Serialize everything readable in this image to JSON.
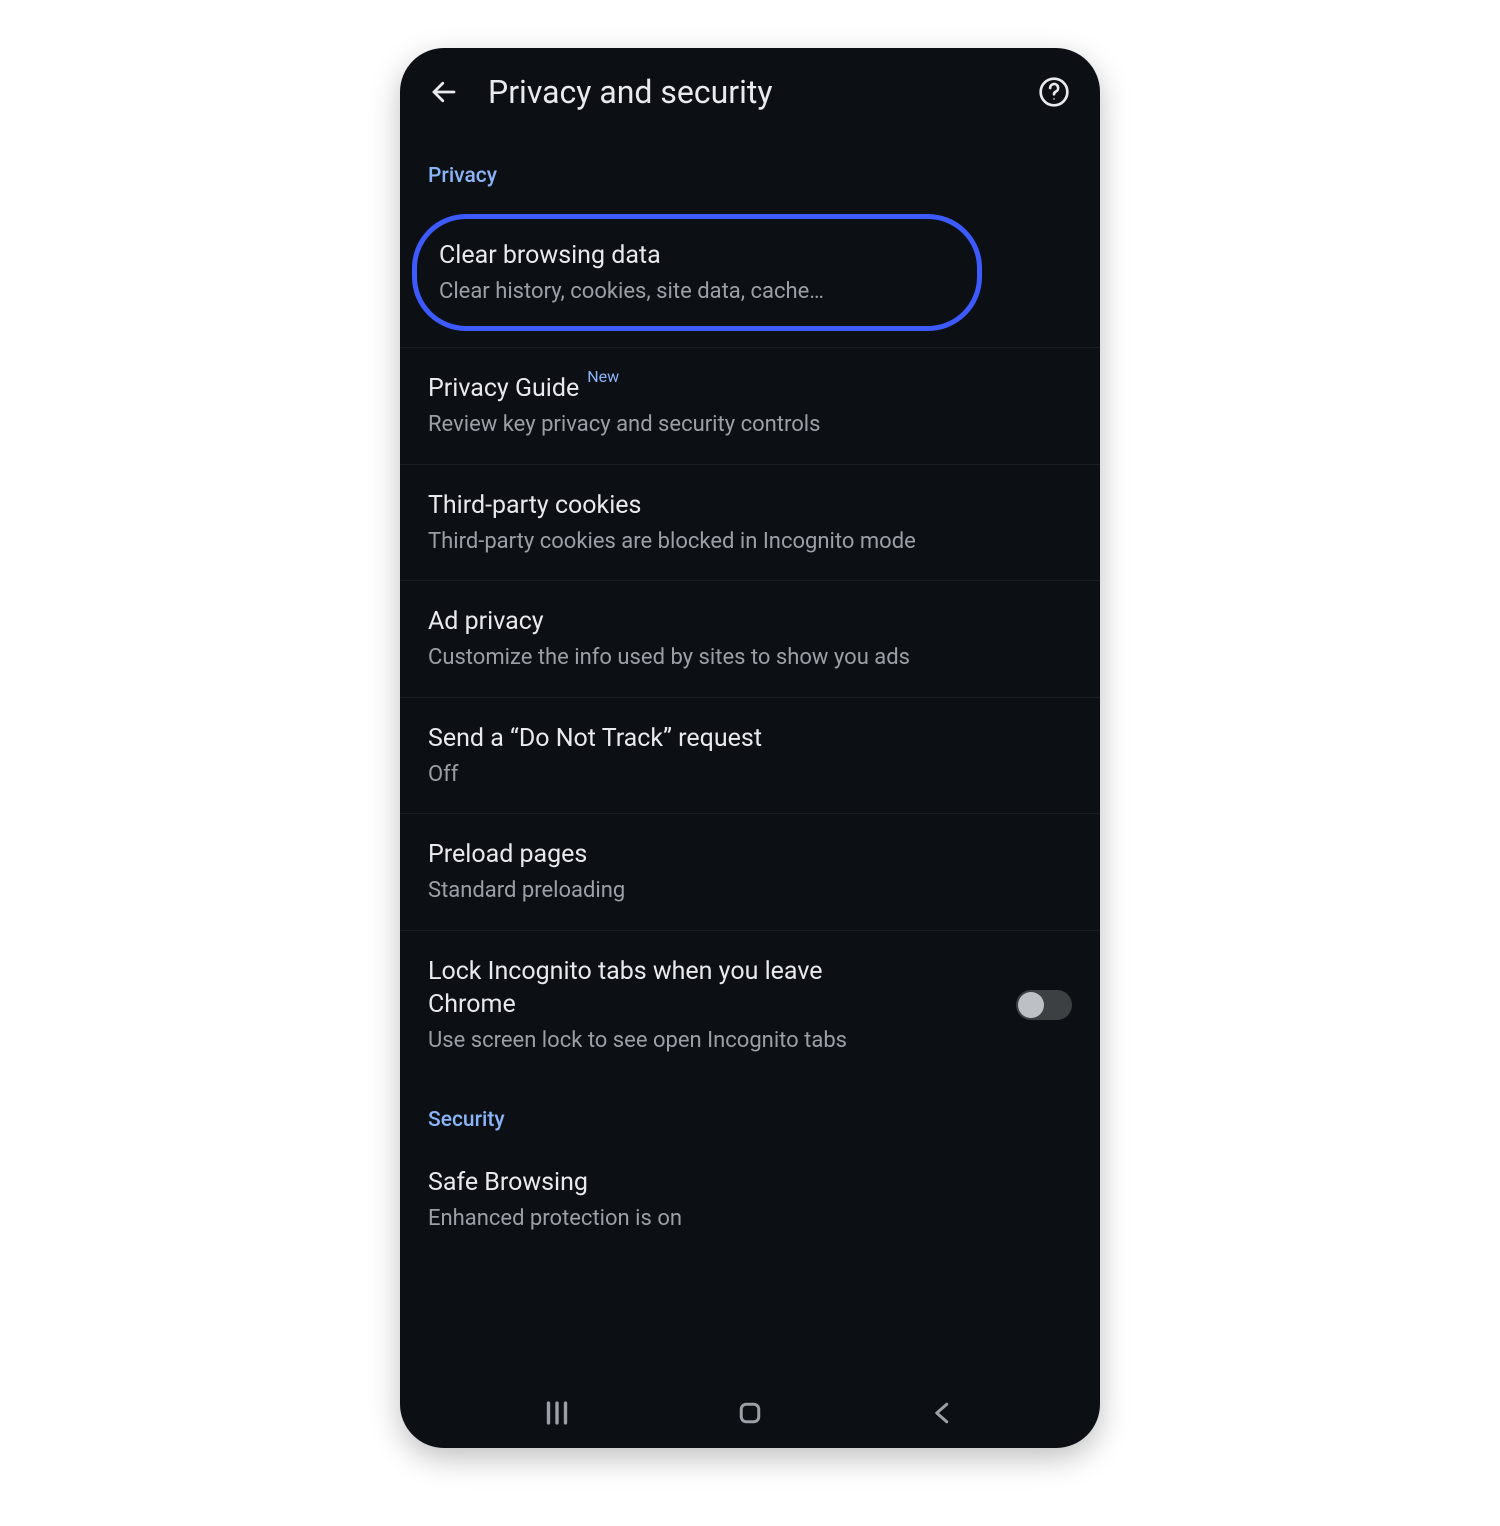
{
  "header": {
    "title": "Privacy and security"
  },
  "sections": {
    "privacy": {
      "label": "Privacy",
      "items": {
        "clear_browsing_data": {
          "title": "Clear browsing data",
          "subtitle": "Clear history, cookies, site data, cache…"
        },
        "privacy_guide": {
          "title": "Privacy Guide",
          "badge": "New",
          "subtitle": "Review key privacy and security controls"
        },
        "third_party_cookies": {
          "title": "Third-party cookies",
          "subtitle": "Third-party cookies are blocked in Incognito mode"
        },
        "ad_privacy": {
          "title": "Ad privacy",
          "subtitle": "Customize the info used by sites to show you ads"
        },
        "do_not_track": {
          "title": "Send a “Do Not Track” request",
          "subtitle": "Off"
        },
        "preload_pages": {
          "title": "Preload pages",
          "subtitle": "Standard preloading"
        },
        "lock_incognito": {
          "title": "Lock Incognito tabs when you leave Chrome",
          "subtitle": "Use screen lock to see open Incognito tabs",
          "toggle": false
        }
      }
    },
    "security": {
      "label": "Security",
      "items": {
        "safe_browsing": {
          "title": "Safe Browsing",
          "subtitle": "Enhanced protection is on"
        }
      }
    }
  }
}
